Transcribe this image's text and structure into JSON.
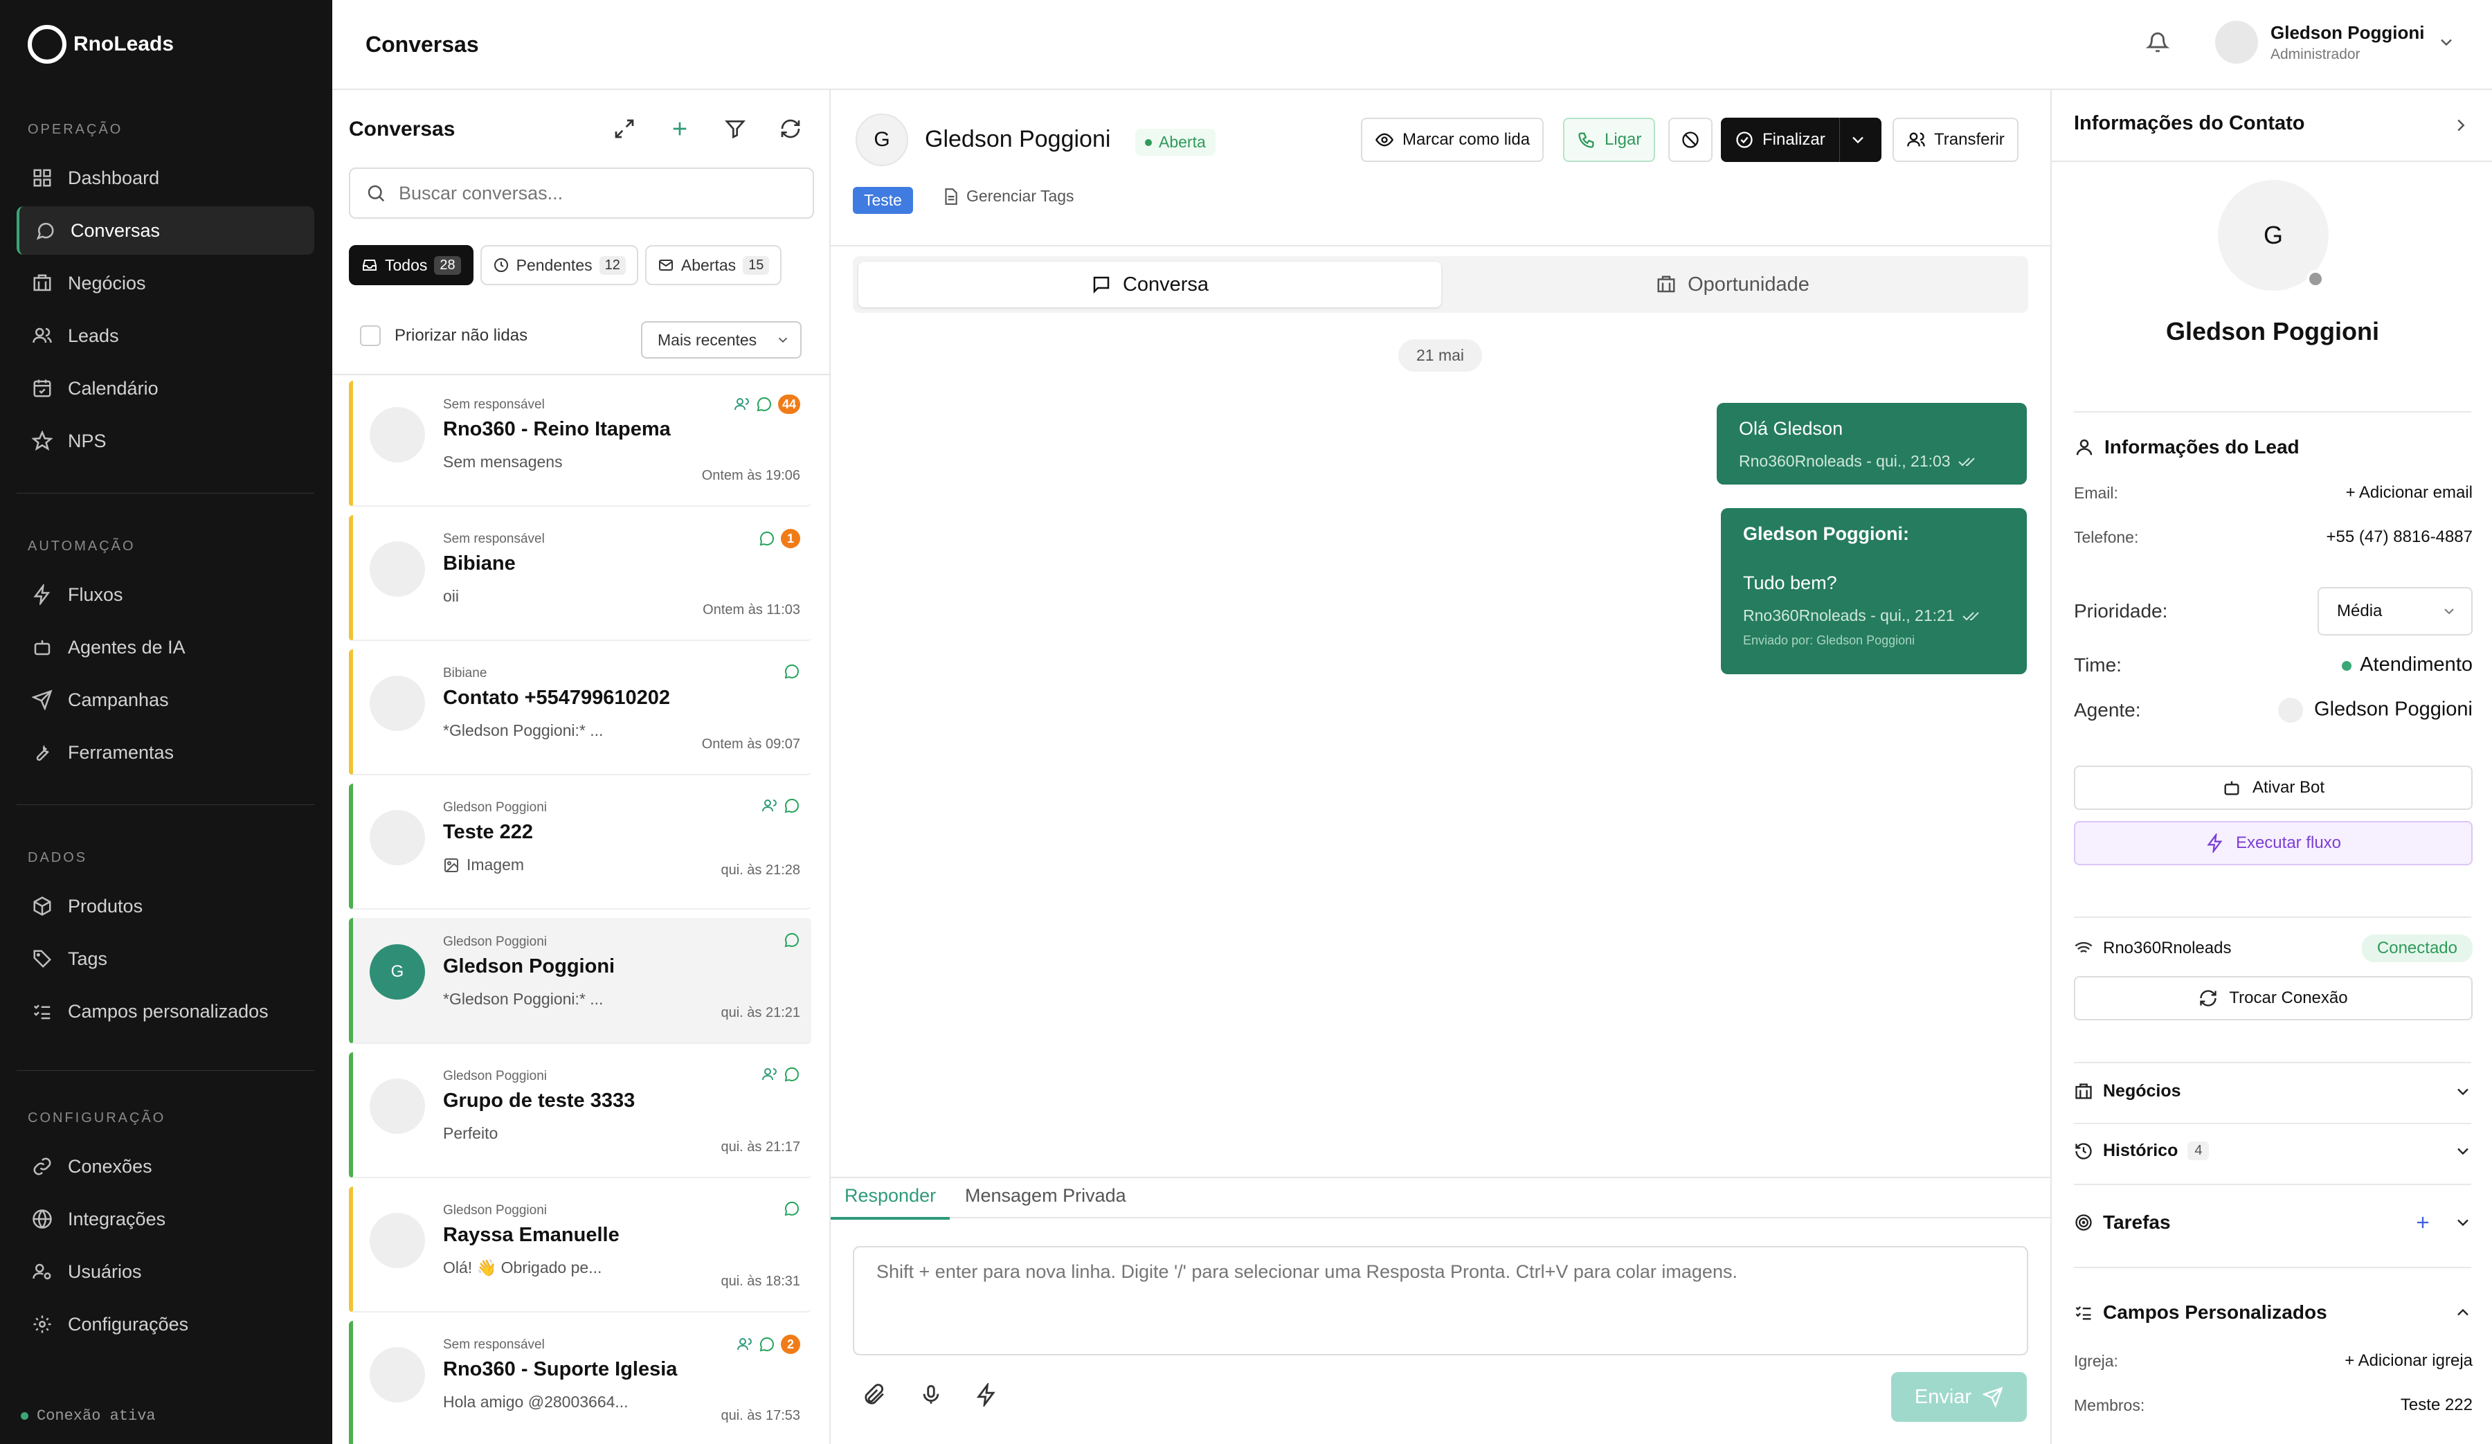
{
  "app": {
    "name": "RnoLeads"
  },
  "sidebar": {
    "sections": [
      {
        "title": "OPERAÇÃO",
        "items": [
          "Dashboard",
          "Conversas",
          "Negócios",
          "Leads",
          "Calendário",
          "NPS"
        ]
      },
      {
        "title": "AUTOMAÇÃO",
        "items": [
          "Fluxos",
          "Agentes de IA",
          "Campanhas",
          "Ferramentas"
        ]
      },
      {
        "title": "DADOS",
        "items": [
          "Produtos",
          "Tags",
          "Campos personalizados"
        ]
      },
      {
        "title": "CONFIGURAÇÃO",
        "items": [
          "Conexões",
          "Integrações",
          "Usuários",
          "Configurações"
        ]
      }
    ],
    "active_item": "Conversas",
    "status": "Conexão ativa"
  },
  "header": {
    "title": "Conversas",
    "user_name": "Gledson Poggioni",
    "user_role": "Administrador"
  },
  "list": {
    "title": "Conversas",
    "search_placeholder": "Buscar conversas...",
    "filters": [
      {
        "label": "Todos",
        "count": "28"
      },
      {
        "label": "Pendentes",
        "count": "12"
      },
      {
        "label": "Abertas",
        "count": "15"
      }
    ],
    "prioritize_label": "Priorizar não lidas",
    "sort": "Mais recentes",
    "conversations": [
      {
        "responsible": "Sem responsável",
        "name": "Rno360 - Reino Itapema",
        "preview": "Sem mensagens",
        "time": "Ontem às 19:06",
        "badge": "44",
        "border": "yellow"
      },
      {
        "responsible": "Sem responsável",
        "name": "Bibiane",
        "preview": "oii",
        "time": "Ontem às 11:03",
        "badge": "1",
        "border": "yellow"
      },
      {
        "responsible": "Bibiane",
        "name": "Contato +554799610202",
        "preview": "*Gledson Poggioni:* ...",
        "time": "Ontem às 09:07",
        "badge": "",
        "border": "yellow"
      },
      {
        "responsible": "Gledson Poggioni",
        "name": "Teste 222",
        "preview": "Imagem",
        "time": "qui. às 21:28",
        "badge": "",
        "border": "green"
      },
      {
        "responsible": "Gledson Poggioni",
        "name": "Gledson Poggioni",
        "preview": "*Gledson Poggioni:* ...",
        "time": "qui. às 21:21",
        "badge": "",
        "border": "green",
        "initial": "G"
      },
      {
        "responsible": "Gledson Poggioni",
        "name": "Grupo de teste 3333",
        "preview": "Perfeito",
        "time": "qui. às 21:17",
        "badge": "",
        "border": "green"
      },
      {
        "responsible": "Gledson Poggioni",
        "name": "Rayssa Emanuelle",
        "preview": "Olá! 👋 Obrigado pe...",
        "time": "qui. às 18:31",
        "badge": "",
        "border": "yellow"
      },
      {
        "responsible": "Sem responsável",
        "name": "Rno360 - Suporte Iglesia",
        "preview": "Hola amigo @28003664...",
        "time": "qui. às 17:53",
        "badge": "2",
        "border": "green"
      }
    ]
  },
  "chat": {
    "contact_initial": "G",
    "contact_name": "Gledson Poggioni",
    "status": "Aberta",
    "actions": {
      "mark_read": "Marcar como lida",
      "call": "Ligar",
      "finish": "Finalizar",
      "transfer": "Transferir"
    },
    "tag": "Teste",
    "manage_tags": "Gerenciar Tags",
    "tabs": [
      "Conversa",
      "Oportunidade"
    ],
    "date_chip": "21 mai",
    "messages": [
      {
        "text": "Olá Gledson",
        "meta": "Rno360Rnoleads -  qui., 21:03"
      },
      {
        "sender": "Gledson Poggioni:",
        "text": "Tudo bem?",
        "meta": "Rno360Rnoleads -  qui., 21:21",
        "sent_by": "Enviado por: Gledson Poggioni"
      }
    ],
    "composer_tabs": [
      "Responder",
      "Mensagem Privada"
    ],
    "composer_placeholder": "Shift + enter para nova linha. Digite '/' para selecionar uma Resposta Pronta. Ctrl+V para colar imagens.",
    "send_label": "Enviar"
  },
  "contact_panel": {
    "title": "Informações do Contato",
    "avatar_initial": "G",
    "name": "Gledson Poggioni",
    "lead_section": "Informações do Lead",
    "email_label": "Email:",
    "email_value": "+ Adicionar email",
    "phone_label": "Telefone:",
    "phone_value": "+55 (47) 8816-4887",
    "priority_label": "Prioridade:",
    "priority_value": "Média",
    "team_label": "Time:",
    "team_value": "Atendimento",
    "agent_label": "Agente:",
    "agent_value": "Gledson Poggioni",
    "activate_bot": "Ativar Bot",
    "run_flow": "Executar fluxo",
    "connection_name": "Rno360Rnoleads",
    "connection_status": "Conectado",
    "switch_connection": "Trocar Conexão",
    "deals": "Negócios",
    "history": "Histórico",
    "history_count": "4",
    "tasks": "Tarefas",
    "custom_fields": "Campos Personalizados",
    "church_label": "Igreja:",
    "church_value": "+ Adicionar igreja",
    "members_label": "Membros:",
    "members_value": "Teste 222"
  },
  "colors": {
    "sidebar_bg": "#141414",
    "accent": "#257c5e",
    "tag_blue": "#3f7be0",
    "badge_orange": "#f07c18"
  }
}
